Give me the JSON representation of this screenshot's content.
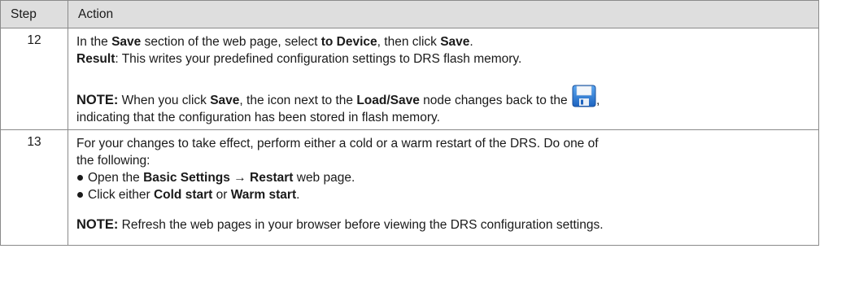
{
  "header": {
    "step": "Step",
    "action": "Action"
  },
  "rows": [
    {
      "step": "12",
      "p1": {
        "t1": "In the ",
        "b1": "Save",
        "t2": " section of the web page, select ",
        "b2": "to Device",
        "t3": ", then click ",
        "b3": "Save",
        "t4": "."
      },
      "p2": {
        "b1": "Result",
        "t1": ": This writes your predefined configuration settings to DRS flash memory."
      },
      "note": {
        "label": "NOTE:",
        "t1": " When you click ",
        "b1": "Save",
        "t2": ", the icon next to the ",
        "b2": "Load/Save",
        "t3": " node changes back to the ",
        "t4": ",",
        "line2": "indicating that the configuration has been stored in flash memory."
      },
      "icon": "floppy-disk-save-icon"
    },
    {
      "step": "13",
      "p1": {
        "line1": "For your changes to take effect, perform either a cold or a warm restart of the DRS. Do one of",
        "line2": "the following:"
      },
      "bullets": [
        {
          "t1": "Open the ",
          "b1": "Basic Settings",
          "arrow": " → ",
          "b2": "Restart",
          "t2": " web page."
        },
        {
          "t1": "Click either ",
          "b1": "Cold start",
          "t2": " or ",
          "b2": "Warm start",
          "t3": "."
        }
      ],
      "note": {
        "label": "NOTE:",
        "t1": " Refresh the web pages in your browser before viewing the DRS configuration settings."
      }
    }
  ],
  "colors": {
    "header_bg": "#dedede",
    "border": "#8a8a8a",
    "text": "#1a1a1a",
    "icon_blue": "#2f7fd8"
  }
}
